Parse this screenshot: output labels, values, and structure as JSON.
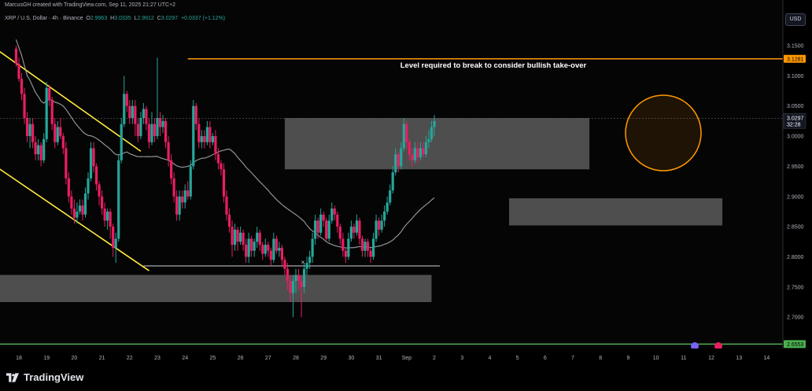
{
  "header": {
    "created_by": "MarcusGH created with TradingView.com, Sep 11, 2025 21:27 UTC+2"
  },
  "symbol": {
    "name": "XRP / U.S. Dollar · 4h · Binance",
    "open_label": "O",
    "open": "2.9963",
    "high_label": "H",
    "high": "3.0335",
    "low_label": "L",
    "low": "2.9912",
    "close_label": "C",
    "close": "3.0297",
    "change": "+0.0337 (+1.12%)"
  },
  "currency_button": "USD",
  "brand": "TradingView",
  "colors": {
    "up": "#26a69a",
    "down": "#e91e63",
    "ma": "#b2b5be",
    "resistance": "#ff9800",
    "support": "#4caf50",
    "channel": "#ffeb3b",
    "zone": "#8a8a8a"
  },
  "chart_data": {
    "type": "candlestick",
    "timeframe": "4h",
    "symbol": "XRPUSD",
    "x_tick_labels": [
      "18",
      "19",
      "20",
      "21",
      "22",
      "23",
      "24",
      "25",
      "26",
      "27",
      "28",
      "29",
      "30",
      "31",
      "Sep",
      "2",
      "3",
      "4",
      "5",
      "6",
      "7",
      "8",
      "9",
      "10",
      "11",
      "12",
      "13",
      "14"
    ],
    "y_tick_labels": [
      "3.1500",
      "3.1000",
      "3.0500",
      "3.0000",
      "2.9500",
      "2.9000",
      "2.8500",
      "2.8000",
      "2.7500",
      "2.7000"
    ],
    "ylim": [
      2.655,
      3.215
    ],
    "price_labels": {
      "resistance": "3.1281",
      "current": "3.0297",
      "countdown": "32:28",
      "support": "2.6553"
    },
    "annotations": {
      "resistance_text": "Level required to break to consider bullish take-over",
      "x_marker": "×"
    },
    "levels": {
      "resistance": 3.1281,
      "support": 2.6553,
      "current": 3.0297,
      "low_line": 2.785
    },
    "zones": [
      {
        "name": "upper-supply-zone",
        "day_from": 27.6,
        "day_to": 38.6,
        "top": 3.03,
        "bottom": 2.945
      },
      {
        "name": "mid-demand-zone",
        "day_from": 35.7,
        "day_to": 43.4,
        "top": 2.897,
        "bottom": 2.852
      },
      {
        "name": "lower-demand-zone",
        "day_from": 17.0,
        "day_to": 32.9,
        "top": 2.77,
        "bottom": 2.725
      }
    ],
    "channel_lines": [
      {
        "from": [
          17.0,
          3.15
        ],
        "to": [
          22.4,
          2.975
        ]
      },
      {
        "from": [
          17.0,
          2.955
        ],
        "to": [
          22.7,
          2.777
        ]
      }
    ],
    "candles": [
      [
        17.9,
        3.145,
        3.12,
        3.15,
        3.115
      ],
      [
        18.0,
        3.12,
        3.095,
        3.13,
        3.09
      ],
      [
        18.1,
        3.095,
        3.07,
        3.105,
        3.06
      ],
      [
        18.2,
        3.07,
        3.03,
        3.08,
        3.02
      ],
      [
        18.3,
        3.03,
        3.0,
        3.04,
        2.99
      ],
      [
        18.4,
        3.0,
        3.02,
        3.03,
        2.98
      ],
      [
        18.5,
        3.02,
        2.99,
        3.03,
        2.98
      ],
      [
        18.6,
        2.99,
        2.97,
        3.0,
        2.96
      ],
      [
        18.7,
        2.97,
        2.985,
        2.995,
        2.96
      ],
      [
        18.8,
        2.985,
        2.96,
        2.99,
        2.95
      ],
      [
        18.9,
        2.96,
        2.995,
        3.005,
        2.955
      ],
      [
        19.0,
        2.995,
        3.08,
        3.09,
        2.99
      ],
      [
        19.1,
        3.08,
        3.06,
        3.085,
        3.05
      ],
      [
        19.2,
        3.06,
        3.02,
        3.065,
        3.01
      ],
      [
        19.3,
        3.02,
        2.99,
        3.03,
        2.98
      ],
      [
        19.4,
        2.99,
        3.015,
        3.025,
        2.985
      ],
      [
        19.5,
        3.015,
        3.0,
        3.03,
        2.995
      ],
      [
        19.6,
        3.0,
        2.98,
        3.005,
        2.97
      ],
      [
        19.7,
        2.98,
        2.93,
        2.99,
        2.92
      ],
      [
        19.8,
        2.93,
        2.9,
        2.94,
        2.89
      ],
      [
        19.9,
        2.9,
        2.88,
        2.91,
        2.87
      ],
      [
        20.0,
        2.88,
        2.865,
        2.895,
        2.855
      ],
      [
        20.1,
        2.865,
        2.875,
        2.89,
        2.855
      ],
      [
        20.2,
        2.875,
        2.885,
        2.895,
        2.87
      ],
      [
        20.3,
        2.885,
        2.87,
        2.895,
        2.86
      ],
      [
        20.4,
        2.87,
        2.905,
        2.915,
        2.865
      ],
      [
        20.5,
        2.905,
        2.93,
        2.94,
        2.895
      ],
      [
        20.6,
        2.93,
        2.98,
        2.99,
        2.925
      ],
      [
        20.7,
        2.98,
        2.95,
        2.99,
        2.94
      ],
      [
        20.8,
        2.95,
        2.92,
        2.955,
        2.91
      ],
      [
        20.9,
        2.92,
        2.9,
        2.925,
        2.885
      ],
      [
        21.0,
        2.9,
        2.88,
        2.91,
        2.87
      ],
      [
        21.1,
        2.88,
        2.86,
        2.89,
        2.85
      ],
      [
        21.2,
        2.86,
        2.875,
        2.88,
        2.845
      ],
      [
        21.3,
        2.875,
        2.85,
        2.88,
        2.83
      ],
      [
        21.4,
        2.85,
        2.815,
        2.855,
        2.8
      ],
      [
        21.5,
        2.815,
        2.83,
        2.84,
        2.79
      ],
      [
        21.6,
        2.83,
        2.96,
        2.97,
        2.825
      ],
      [
        21.7,
        2.96,
        3.02,
        3.03,
        2.955
      ],
      [
        21.8,
        3.02,
        3.07,
        3.1,
        3.015
      ],
      [
        21.9,
        3.07,
        3.05,
        3.075,
        3.04
      ],
      [
        22.0,
        3.05,
        3.03,
        3.06,
        3.02
      ],
      [
        22.1,
        3.03,
        3.05,
        3.06,
        3.02
      ],
      [
        22.2,
        3.05,
        3.02,
        3.06,
        3.0
      ],
      [
        22.3,
        3.02,
        3.0,
        3.03,
        2.99
      ],
      [
        22.4,
        3.0,
        3.03,
        3.04,
        2.995
      ],
      [
        22.5,
        3.03,
        3.045,
        3.055,
        3.02
      ],
      [
        22.6,
        3.045,
        3.02,
        3.05,
        3.01
      ],
      [
        22.7,
        3.02,
        2.99,
        3.03,
        2.98
      ],
      [
        22.8,
        2.99,
        3.02,
        3.04,
        2.985
      ],
      [
        22.9,
        3.02,
        3.0,
        3.03,
        2.99
      ],
      [
        23.0,
        3.0,
        3.03,
        3.13,
        2.995
      ],
      [
        23.1,
        3.03,
        3.015,
        3.04,
        3.0
      ],
      [
        23.2,
        3.015,
        3.025,
        3.035,
        3.005
      ],
      [
        23.3,
        3.025,
        2.99,
        3.03,
        2.98
      ],
      [
        23.4,
        2.99,
        2.96,
        3.0,
        2.95
      ],
      [
        23.5,
        2.96,
        2.93,
        2.97,
        2.92
      ],
      [
        23.6,
        2.93,
        2.9,
        2.94,
        2.89
      ],
      [
        23.7,
        2.9,
        2.87,
        2.91,
        2.86
      ],
      [
        23.8,
        2.87,
        2.9,
        2.91,
        2.86
      ],
      [
        23.9,
        2.9,
        2.89,
        2.91,
        2.88
      ],
      [
        24.0,
        2.89,
        2.91,
        2.92,
        2.88
      ],
      [
        24.1,
        2.91,
        2.9,
        2.925,
        2.895
      ],
      [
        24.2,
        2.9,
        2.95,
        2.96,
        2.895
      ],
      [
        24.3,
        2.95,
        3.05,
        3.06,
        2.945
      ],
      [
        24.4,
        3.05,
        3.02,
        3.055,
        3.01
      ],
      [
        24.5,
        3.02,
        2.99,
        3.03,
        2.98
      ],
      [
        24.6,
        2.99,
        3.0,
        3.01,
        2.98
      ],
      [
        24.7,
        3.0,
        2.99,
        3.01,
        2.98
      ],
      [
        24.8,
        2.99,
        3.015,
        3.025,
        2.985
      ],
      [
        24.9,
        3.015,
        2.99,
        3.025,
        2.98
      ],
      [
        25.0,
        2.99,
        3.0,
        3.005,
        2.985
      ],
      [
        25.1,
        3.0,
        2.97,
        3.01,
        2.96
      ],
      [
        25.2,
        2.97,
        2.955,
        2.98,
        2.945
      ],
      [
        25.3,
        2.955,
        2.945,
        2.96,
        2.935
      ],
      [
        25.4,
        2.945,
        2.9,
        2.955,
        2.89
      ],
      [
        25.5,
        2.9,
        2.87,
        2.91,
        2.86
      ],
      [
        25.6,
        2.87,
        2.85,
        2.88,
        2.84
      ],
      [
        25.7,
        2.85,
        2.82,
        2.86,
        2.8
      ],
      [
        25.8,
        2.82,
        2.845,
        2.855,
        2.81
      ],
      [
        25.9,
        2.845,
        2.825,
        2.85,
        2.81
      ],
      [
        26.0,
        2.825,
        2.84,
        2.85,
        2.82
      ],
      [
        26.1,
        2.84,
        2.82,
        2.845,
        2.81
      ],
      [
        26.2,
        2.82,
        2.8,
        2.83,
        2.79
      ],
      [
        26.3,
        2.8,
        2.83,
        2.84,
        2.79
      ],
      [
        26.4,
        2.83,
        2.81,
        2.835,
        2.8
      ],
      [
        26.5,
        2.81,
        2.825,
        2.83,
        2.8
      ],
      [
        26.6,
        2.825,
        2.84,
        2.85,
        2.815
      ],
      [
        26.7,
        2.84,
        2.82,
        2.845,
        2.81
      ],
      [
        26.8,
        2.82,
        2.805,
        2.825,
        2.795
      ],
      [
        26.9,
        2.805,
        2.82,
        2.83,
        2.8
      ],
      [
        27.0,
        2.82,
        2.81,
        2.825,
        2.8
      ],
      [
        27.1,
        2.81,
        2.795,
        2.815,
        2.785
      ],
      [
        27.2,
        2.795,
        2.83,
        2.84,
        2.79
      ],
      [
        27.3,
        2.83,
        2.81,
        2.835,
        2.805
      ],
      [
        27.4,
        2.81,
        2.815,
        2.825,
        2.8
      ],
      [
        27.5,
        2.815,
        2.795,
        2.82,
        2.785
      ],
      [
        27.6,
        2.795,
        2.78,
        2.8,
        2.77
      ],
      [
        27.7,
        2.78,
        2.76,
        2.79,
        2.745
      ],
      [
        27.8,
        2.76,
        2.74,
        2.77,
        2.725
      ],
      [
        27.9,
        2.74,
        2.76,
        2.77,
        2.7
      ],
      [
        28.0,
        2.76,
        2.77,
        2.78,
        2.74
      ],
      [
        28.1,
        2.77,
        2.76,
        2.78,
        2.745
      ],
      [
        28.2,
        2.76,
        2.75,
        2.77,
        2.7
      ],
      [
        28.3,
        2.75,
        2.78,
        2.79,
        2.74
      ],
      [
        28.4,
        2.78,
        2.79,
        2.8,
        2.77
      ],
      [
        28.5,
        2.79,
        2.8,
        2.81,
        2.78
      ],
      [
        28.6,
        2.8,
        2.83,
        2.84,
        2.79
      ],
      [
        28.7,
        2.83,
        2.86,
        2.87,
        2.82
      ],
      [
        28.8,
        2.86,
        2.84,
        2.865,
        2.83
      ],
      [
        28.9,
        2.84,
        2.87,
        2.88,
        2.835
      ],
      [
        29.0,
        2.87,
        2.86,
        2.875,
        2.85
      ],
      [
        29.1,
        2.86,
        2.83,
        2.865,
        2.825
      ],
      [
        29.2,
        2.83,
        2.86,
        2.87,
        2.825
      ],
      [
        29.3,
        2.86,
        2.88,
        2.89,
        2.855
      ],
      [
        29.4,
        2.88,
        2.87,
        2.885,
        2.86
      ],
      [
        29.5,
        2.87,
        2.85,
        2.875,
        2.84
      ],
      [
        29.6,
        2.85,
        2.83,
        2.855,
        2.82
      ],
      [
        29.7,
        2.83,
        2.81,
        2.84,
        2.8
      ],
      [
        29.8,
        2.81,
        2.8,
        2.815,
        2.79
      ],
      [
        29.9,
        2.8,
        2.83,
        2.84,
        2.795
      ],
      [
        30.0,
        2.83,
        2.85,
        2.86,
        2.825
      ],
      [
        30.1,
        2.85,
        2.84,
        2.855,
        2.83
      ],
      [
        30.2,
        2.84,
        2.86,
        2.87,
        2.835
      ],
      [
        30.3,
        2.86,
        2.83,
        2.865,
        2.82
      ],
      [
        30.4,
        2.83,
        2.81,
        2.835,
        2.8
      ],
      [
        30.5,
        2.81,
        2.825,
        2.83,
        2.8
      ],
      [
        30.6,
        2.825,
        2.81,
        2.83,
        2.8
      ],
      [
        30.7,
        2.81,
        2.8,
        2.815,
        2.79
      ],
      [
        30.8,
        2.8,
        2.83,
        2.84,
        2.795
      ],
      [
        30.9,
        2.83,
        2.86,
        2.87,
        2.825
      ],
      [
        31.0,
        2.86,
        2.845,
        2.865,
        2.835
      ],
      [
        31.1,
        2.845,
        2.86,
        2.87,
        2.84
      ],
      [
        31.2,
        2.86,
        2.875,
        2.885,
        2.85
      ],
      [
        31.3,
        2.875,
        2.89,
        2.9,
        2.87
      ],
      [
        31.4,
        2.89,
        2.91,
        2.92,
        2.885
      ],
      [
        31.5,
        2.91,
        2.94,
        2.95,
        2.905
      ],
      [
        31.6,
        2.94,
        2.97,
        2.98,
        2.935
      ],
      [
        31.7,
        2.97,
        2.95,
        2.975,
        2.94
      ],
      [
        31.8,
        2.95,
        2.98,
        2.99,
        2.945
      ],
      [
        31.9,
        2.98,
        3.02,
        3.03,
        2.975
      ],
      [
        32.0,
        3.02,
        2.99,
        3.025,
        2.98
      ],
      [
        32.1,
        2.99,
        2.97,
        2.995,
        2.96
      ],
      [
        32.2,
        2.97,
        2.96,
        2.98,
        2.95
      ],
      [
        32.3,
        2.96,
        2.98,
        2.99,
        2.955
      ],
      [
        32.4,
        2.98,
        2.965,
        2.99,
        2.955
      ],
      [
        32.5,
        2.965,
        2.98,
        2.99,
        2.96
      ],
      [
        32.6,
        2.98,
        2.97,
        2.99,
        2.965
      ],
      [
        32.7,
        2.97,
        2.99,
        3.0,
        2.965
      ],
      [
        32.8,
        2.99,
        2.995,
        3.01,
        2.98
      ],
      [
        32.9,
        2.995,
        3.015,
        3.025,
        2.99
      ],
      [
        33.0,
        3.015,
        3.025,
        3.035,
        3.0
      ]
    ]
  }
}
